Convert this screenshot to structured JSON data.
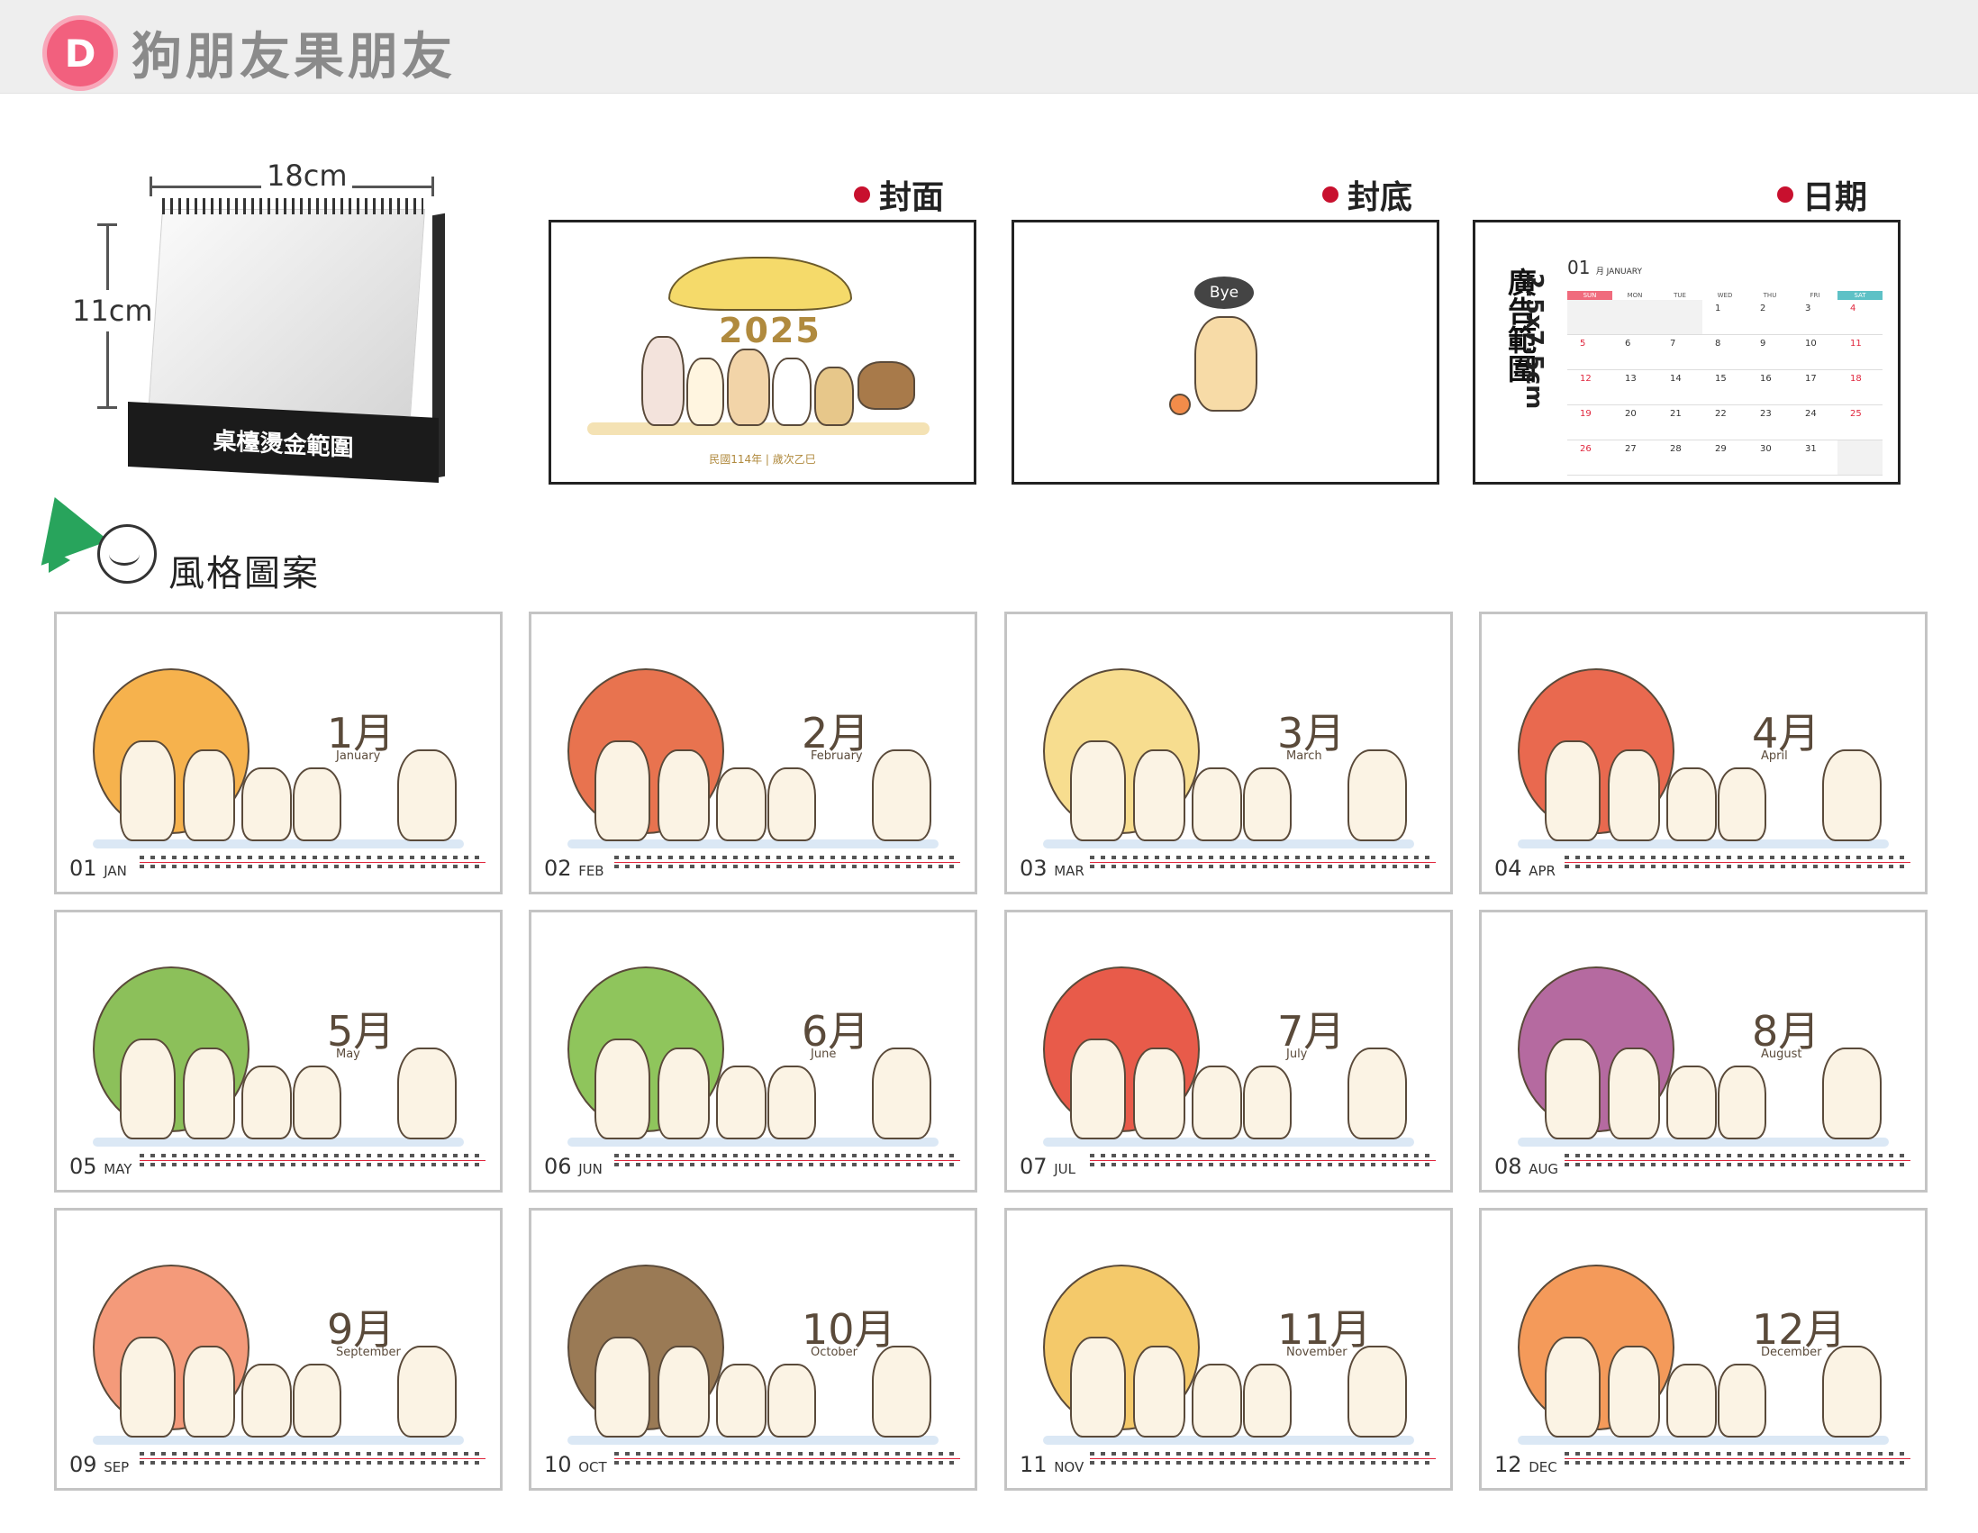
{
  "header": {
    "badge": "D",
    "title": "狗朋友果朋友"
  },
  "mockup": {
    "width_label": "18cm",
    "height_label": "11cm",
    "base_label": "桌檯燙金範圍"
  },
  "previews": {
    "cover": {
      "label": "封面",
      "year": "2025",
      "footer": "民國114年 | 歲次乙巳"
    },
    "back": {
      "label": "封底",
      "bubble": "Bye"
    },
    "date": {
      "label": "日期",
      "ad_area": "廣告範圍",
      "ad_size": "2.5x7.5cm",
      "month_num": "01",
      "month_small": "月 JANUARY",
      "weekdays": [
        "SUN",
        "MON",
        "TUE",
        "WED",
        "THU",
        "FRI",
        "SAT"
      ],
      "days": [
        "",
        "",
        "",
        "1",
        "2",
        "3",
        "4",
        "5",
        "6",
        "7",
        "8",
        "9",
        "10",
        "11",
        "12",
        "13",
        "14",
        "15",
        "16",
        "17",
        "18",
        "19",
        "20",
        "21",
        "22",
        "23",
        "24",
        "25",
        "26",
        "27",
        "28",
        "29",
        "30",
        "31",
        ""
      ]
    }
  },
  "style_section": {
    "title": "風格圖案"
  },
  "months": [
    {
      "num": "01",
      "abbr": "JAN",
      "big": "1月",
      "eng": "January",
      "fruit_color": "#f6b24d"
    },
    {
      "num": "02",
      "abbr": "FEB",
      "big": "2月",
      "eng": "February",
      "fruit_color": "#e8734f"
    },
    {
      "num": "03",
      "abbr": "MAR",
      "big": "3月",
      "eng": "March",
      "fruit_color": "#f7dd8f"
    },
    {
      "num": "04",
      "abbr": "APR",
      "big": "4月",
      "eng": "April",
      "fruit_color": "#e9694f"
    },
    {
      "num": "05",
      "abbr": "MAY",
      "big": "5月",
      "eng": "May",
      "fruit_color": "#8cc05a"
    },
    {
      "num": "06",
      "abbr": "JUN",
      "big": "6月",
      "eng": "June",
      "fruit_color": "#8fc55c"
    },
    {
      "num": "07",
      "abbr": "JUL",
      "big": "7月",
      "eng": "July",
      "fruit_color": "#e85b4a"
    },
    {
      "num": "08",
      "abbr": "AUG",
      "big": "8月",
      "eng": "August",
      "fruit_color": "#b56aa0"
    },
    {
      "num": "09",
      "abbr": "SEP",
      "big": "9月",
      "eng": "September",
      "fruit_color": "#f49a7a"
    },
    {
      "num": "10",
      "abbr": "OCT",
      "big": "10月",
      "eng": "October",
      "fruit_color": "#9a7a55"
    },
    {
      "num": "11",
      "abbr": "NOV",
      "big": "11月",
      "eng": "November",
      "fruit_color": "#f4c96a"
    },
    {
      "num": "12",
      "abbr": "DEC",
      "big": "12月",
      "eng": "December",
      "fruit_color": "#f49a5a"
    }
  ]
}
